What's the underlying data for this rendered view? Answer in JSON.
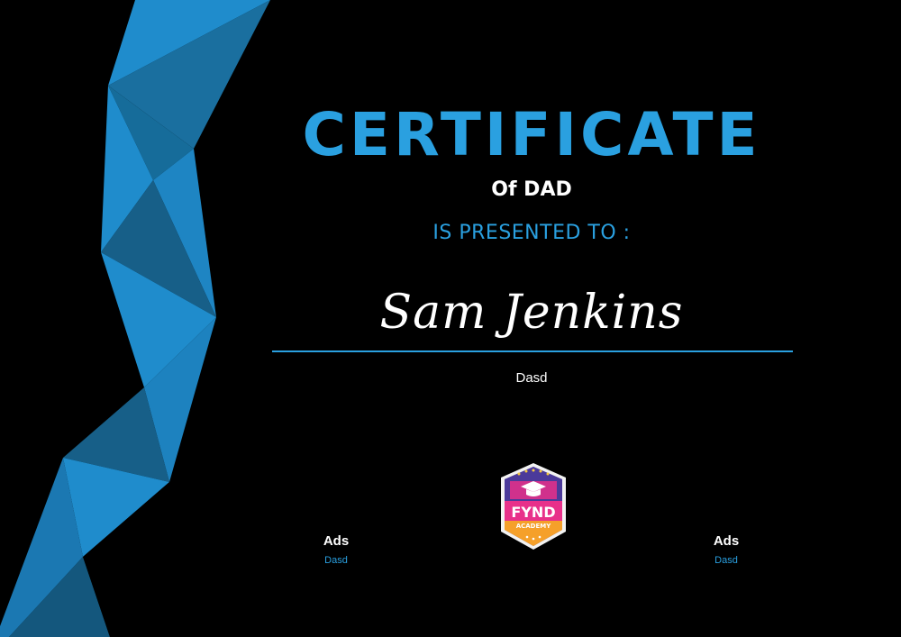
{
  "certificate": {
    "title": "CERTIFICATE",
    "subtitle": "Of DAD",
    "presented_to": "IS PRESENTED TO :",
    "recipient": "Sam Jenkins",
    "description": "Dasd"
  },
  "signatures": [
    {
      "name": "Ads",
      "role": "Dasd"
    },
    {
      "name": "Ads",
      "role": "Dasd"
    }
  ],
  "logo": {
    "line1": "FYND",
    "line2": "ACADEMY",
    "icon": "graduation-cap-icon"
  },
  "colors": {
    "accent": "#2aa0e0",
    "background": "#000000",
    "text": "#ffffff",
    "logo_pink": "#e8308a",
    "logo_orange": "#f5a02a",
    "logo_purple": "#4b3a9a"
  }
}
